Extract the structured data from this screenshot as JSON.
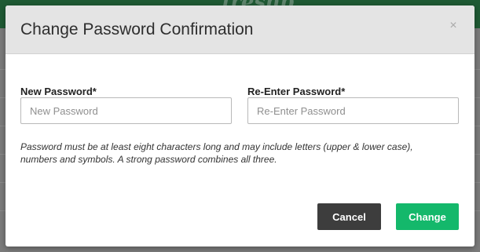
{
  "background": {
    "logo_text": "freshb"
  },
  "modal": {
    "title": "Change Password Confirmation",
    "close_glyph": "×",
    "new_password": {
      "label": "New Password*",
      "placeholder": "New Password",
      "value": ""
    },
    "reenter_password": {
      "label": "Re-Enter Password*",
      "placeholder": "Re-Enter Password",
      "value": ""
    },
    "hint": "Password must be at least eight characters long and may include letters (upper & lower case), numbers and symbols. A strong password combines all three.",
    "cancel_label": "Cancel",
    "change_label": "Change"
  },
  "colors": {
    "header_bg": "#e4e4e4",
    "cancel_bg": "#3d3d3d",
    "change_bg": "#14b86b",
    "app_header": "#1f5a34"
  },
  "icons": {
    "close": "close-icon"
  }
}
